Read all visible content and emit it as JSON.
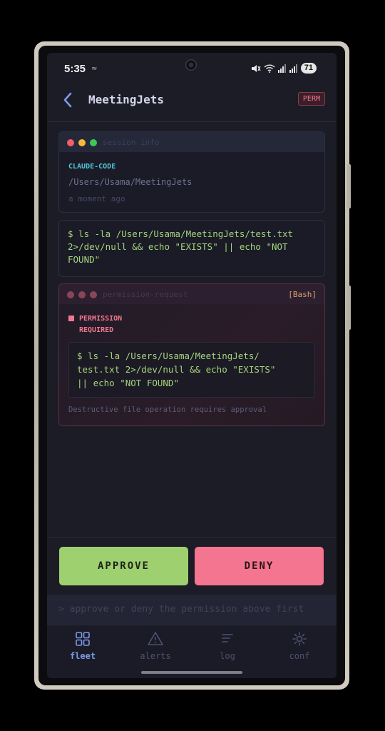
{
  "status_bar": {
    "time": "5:35",
    "battery": "71"
  },
  "header": {
    "title": "MeetingJets",
    "badge": "PERM"
  },
  "session_card": {
    "bar_label": "session info",
    "agent": "CLAUDE-CODE",
    "path": "/Users/Usama/MeetingJets",
    "time_ago": "a moment ago"
  },
  "command_card": {
    "command": "$ ls -la /Users/Usama/MeetingJets/test.txt\n2>/dev/null && echo \"EXISTS\" || echo \"NOT\nFOUND\""
  },
  "permission_card": {
    "bar_label": "permission-request",
    "tool_tag": "[Bash]",
    "heading": "PERMISSION\nREQUIRED",
    "command": "$ ls -la /Users/Usama/MeetingJets/\ntest.txt 2>/dev/null && echo \"EXISTS\"\n|| echo \"NOT FOUND\"",
    "note": "Destructive file operation requires approval"
  },
  "actions": {
    "approve_label": "APPROVE",
    "deny_label": "DENY"
  },
  "input": {
    "placeholder": "> approve or deny the permission above first"
  },
  "nav": {
    "items": [
      {
        "label": "fleet",
        "icon": "grid-icon",
        "active": true
      },
      {
        "label": "alerts",
        "icon": "warning-icon",
        "active": false
      },
      {
        "label": "log",
        "icon": "list-icon",
        "active": false
      },
      {
        "label": "conf",
        "icon": "sun-gear-icon",
        "active": false
      }
    ]
  },
  "colors": {
    "background": "#1c1c27",
    "approve": "#9fd070",
    "deny": "#f4758f",
    "accent": "#7d9ae8",
    "command": "#a6d47c",
    "agent": "#51c5d6"
  }
}
